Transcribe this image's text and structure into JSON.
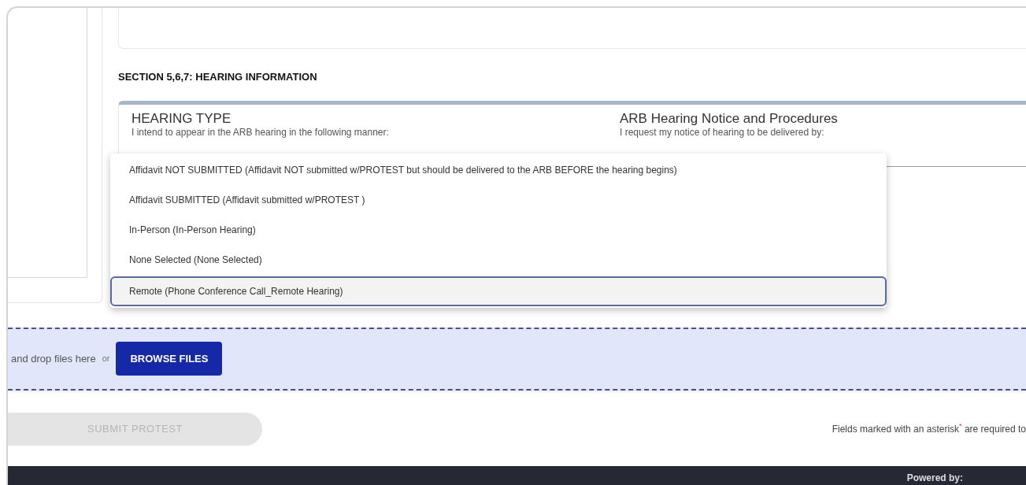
{
  "section_heading": "SECTION 5,6,7: HEARING INFORMATION",
  "hearing_type": {
    "title": "HEARING TYPE",
    "subtitle": "I intend to appear in the ARB hearing in the following manner:",
    "options": [
      {
        "label": "Affidavit NOT SUBMITTED (Affidavit NOT submitted w/PROTEST but should be delivered to the ARB BEFORE the hearing begins)",
        "selected": false
      },
      {
        "label": "Affidavit SUBMITTED (Affidavit submitted w/PROTEST )",
        "selected": false
      },
      {
        "label": "In-Person (In-Person Hearing)",
        "selected": false
      },
      {
        "label": "None Selected (None Selected)",
        "selected": false
      },
      {
        "label": "Remote (Phone Conference Call_Remote Hearing)",
        "selected": true
      }
    ]
  },
  "arb_notice": {
    "title": "ARB Hearing Notice and Procedures",
    "subtitle": "I request my notice of hearing to be delivered by:"
  },
  "dropzone": {
    "text": "and drop files here",
    "or": "or",
    "button": "BROWSE FILES"
  },
  "submit": {
    "label": "SUBMIT PROTEST",
    "disabled": true
  },
  "required_note": "Fields marked with an asterisk$^{*}$ are required to",
  "footer": {
    "powered_by": "Powered by:"
  }
}
